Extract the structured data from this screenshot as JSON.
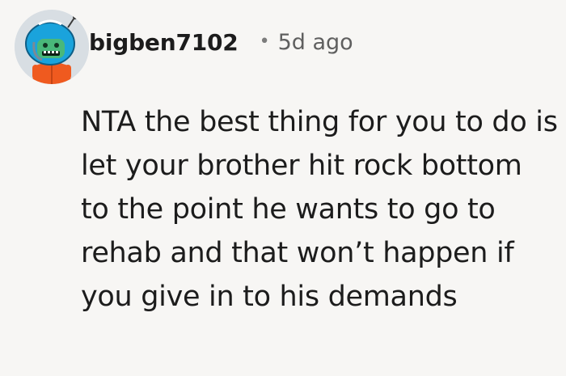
{
  "comment": {
    "username": "bigben7102",
    "separator": "•",
    "timestamp": "5d ago",
    "avatar_icon": "snoo-avatar-icon",
    "text": "NTA the best thing for you to do is let your brother hit rock bottom to the point he wants to go to rehab and that won’t happen if you give in to his demands"
  },
  "colors": {
    "background": "#f7f6f4",
    "text": "#1c1c1c",
    "meta_text": "#5f5f5f",
    "avatar_bg": "#d8dee3",
    "helmet_blue": "#1aa3dc",
    "face_green": "#49b87a",
    "shirt_orange": "#ef5a1f"
  }
}
